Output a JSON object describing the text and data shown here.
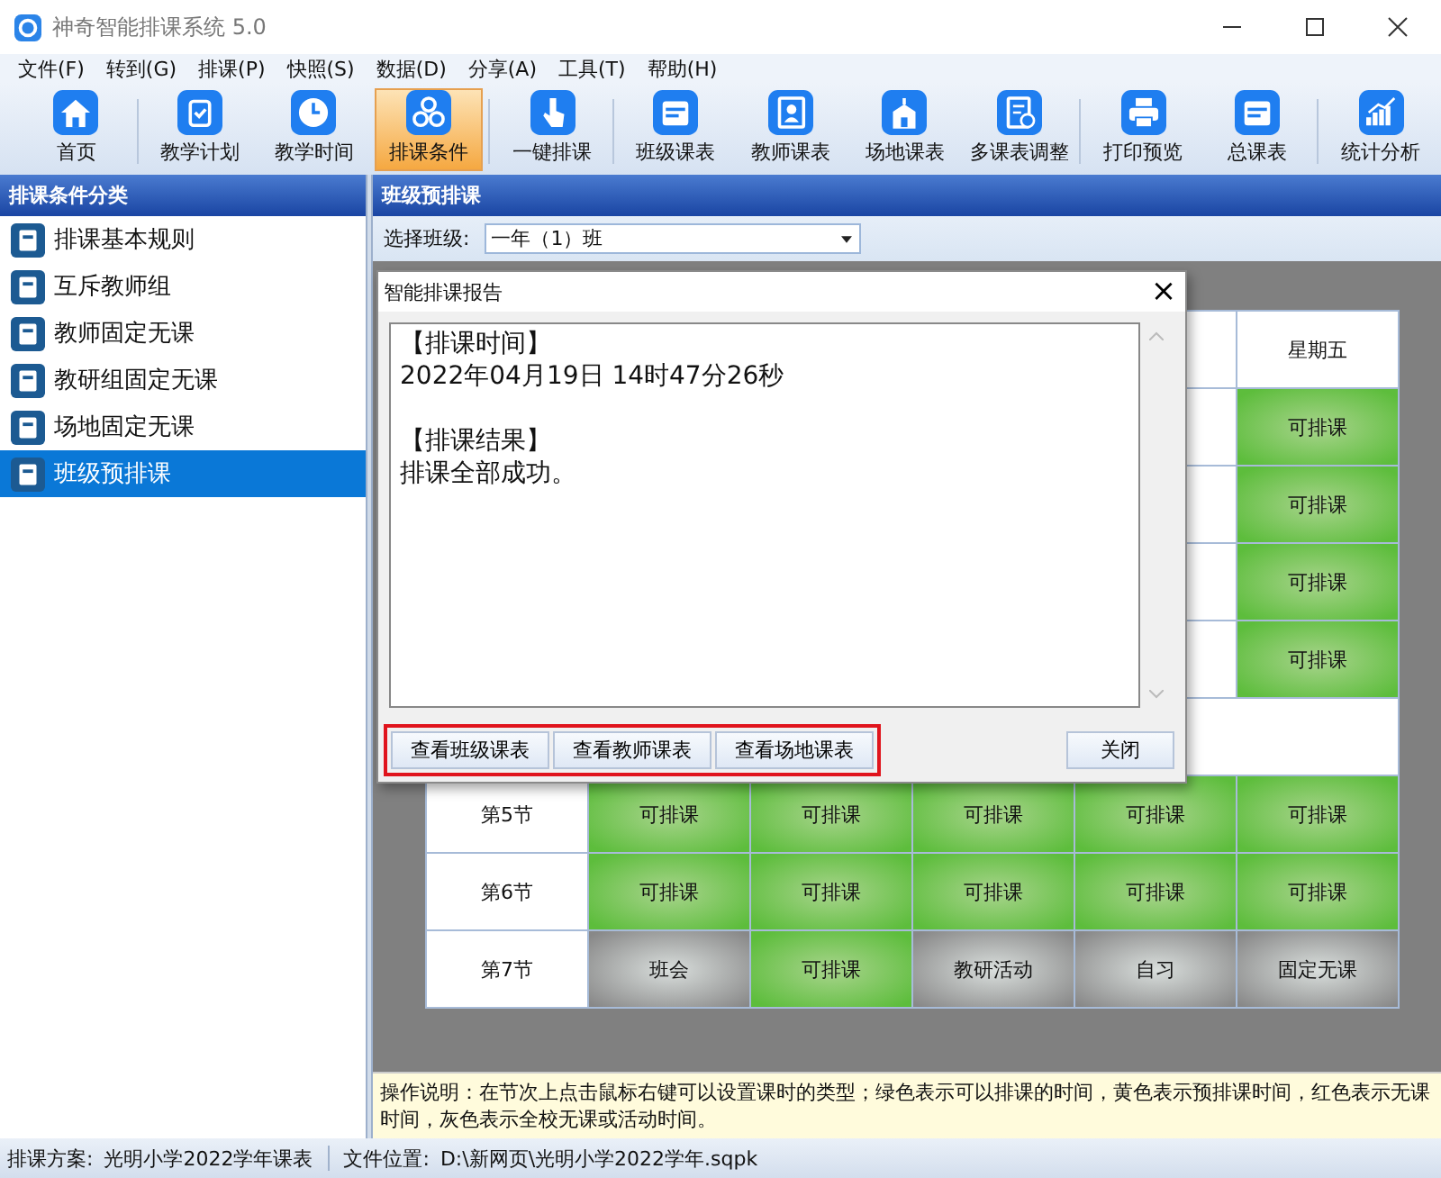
{
  "window": {
    "title": "神奇智能排课系统 5.0"
  },
  "menu": [
    "文件(F)",
    "转到(G)",
    "排课(P)",
    "快照(S)",
    "数据(D)",
    "分享(A)",
    "工具(T)",
    "帮助(H)"
  ],
  "toolbar": [
    {
      "label": "首页",
      "selected": false,
      "divider_after": true
    },
    {
      "label": "教学计划",
      "selected": false,
      "divider_after": false
    },
    {
      "label": "教学时间",
      "selected": false,
      "divider_after": false
    },
    {
      "label": "排课条件",
      "selected": true,
      "divider_after": true
    },
    {
      "label": "一键排课",
      "selected": false,
      "divider_after": true
    },
    {
      "label": "班级课表",
      "selected": false,
      "divider_after": false
    },
    {
      "label": "教师课表",
      "selected": false,
      "divider_after": false
    },
    {
      "label": "场地课表",
      "selected": false,
      "divider_after": false
    },
    {
      "label": "多课表调整",
      "selected": false,
      "divider_after": true
    },
    {
      "label": "打印预览",
      "selected": false,
      "divider_after": false
    },
    {
      "label": "总课表",
      "selected": false,
      "divider_after": true
    },
    {
      "label": "统计分析",
      "selected": false,
      "divider_after": false
    }
  ],
  "sidebar": {
    "title": "排课条件分类",
    "items": [
      {
        "label": "排课基本规则",
        "selected": false
      },
      {
        "label": "互斥教师组",
        "selected": false
      },
      {
        "label": "教师固定无课",
        "selected": false
      },
      {
        "label": "教研组固定无课",
        "selected": false
      },
      {
        "label": "场地固定无课",
        "selected": false
      },
      {
        "label": "班级预排课",
        "selected": true
      }
    ]
  },
  "main": {
    "title": "班级预排课",
    "class_label": "选择班级:",
    "class_value": "一年（1）班",
    "timetable": {
      "columns": [
        "星期五"
      ],
      "rows": [
        {
          "kind": "period",
          "cells": [
            {
              "kind": "available",
              "text": "可排课"
            }
          ]
        },
        {
          "kind": "period",
          "cells": [
            {
              "kind": "available",
              "text": "可排课"
            }
          ]
        },
        {
          "kind": "period",
          "cells": [
            {
              "kind": "available",
              "text": "可排课"
            }
          ]
        },
        {
          "kind": "period",
          "cells": [
            {
              "kind": "available",
              "text": "可排课"
            }
          ]
        },
        {
          "kind": "break",
          "cells": []
        },
        {
          "kind": "period",
          "label": "第5节",
          "cells": [
            {
              "kind": "available",
              "text": "可排课"
            },
            {
              "kind": "available",
              "text": "可排课"
            },
            {
              "kind": "available",
              "text": "可排课"
            },
            {
              "kind": "available",
              "text": "可排课"
            },
            {
              "kind": "available",
              "text": "可排课"
            }
          ]
        },
        {
          "kind": "period",
          "label": "第6节",
          "cells": [
            {
              "kind": "available",
              "text": "可排课"
            },
            {
              "kind": "available",
              "text": "可排课"
            },
            {
              "kind": "available",
              "text": "可排课"
            },
            {
              "kind": "available",
              "text": "可排课"
            },
            {
              "kind": "available",
              "text": "可排课"
            }
          ]
        },
        {
          "kind": "period",
          "label": "第7节",
          "cells": [
            {
              "kind": "blocked",
              "text": "班会"
            },
            {
              "kind": "available",
              "text": "可排课"
            },
            {
              "kind": "blocked",
              "text": "教研活动"
            },
            {
              "kind": "blocked",
              "text": "自习"
            },
            {
              "kind": "blocked",
              "text": "固定无课"
            }
          ]
        }
      ]
    },
    "instructions": "操作说明：在节次上点击鼠标右键可以设置课时的类型；绿色表示可以排课的时间，黄色表示预排课时间，红色表示无课时间，灰色表示全校无课或活动时间。"
  },
  "dialog": {
    "title": "智能排课报告",
    "close": "×",
    "report": [
      {
        "heading": "【排课时间】",
        "body": "2022年04月19日  14时47分26秒"
      },
      {
        "heading": "【排课结果】",
        "body": "排课全部成功。"
      }
    ],
    "actions_highlighted": true,
    "actions": [
      "查看班级课表",
      "查看教师课表",
      "查看场地课表"
    ],
    "close_button": "关闭"
  },
  "status_bar": [
    {
      "label": "排课方案:",
      "value": "光明小学2022学年课表"
    },
    {
      "label": "文件位置:",
      "value": "D:\\新网页\\光明小学2022学年.sqpk"
    }
  ]
}
